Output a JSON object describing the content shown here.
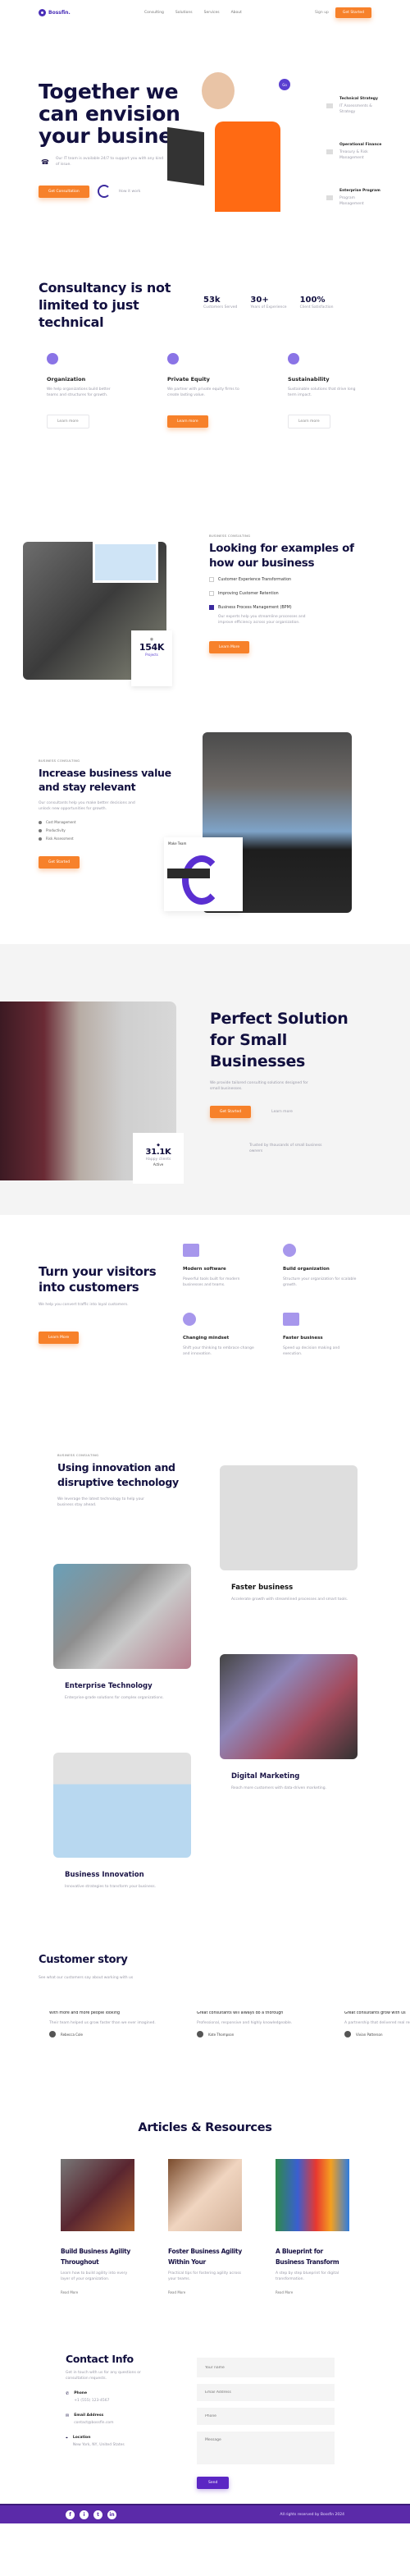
{
  "nav": {
    "brand": "Bossfin.",
    "links": [
      "Consulting",
      "Solutions",
      "Services",
      "About"
    ],
    "login": "Sign up",
    "cta": "Get Started"
  },
  "hero": {
    "title": "Together we can envision your business",
    "desc": "Our IT team is available 24/7 to support you with any kind of issue.",
    "cta": "Get Consultation",
    "video": "How it work",
    "badge": "Go",
    "features": [
      {
        "title": "Technical Strategy",
        "desc": "IT Assessments & Strategy"
      },
      {
        "title": "Operational Finance",
        "desc": "Treasury & Risk Management"
      },
      {
        "title": "Enterprise Program",
        "desc": "Program Management"
      }
    ]
  },
  "consult": {
    "title": "Consultancy is not limited to just technical",
    "stats": [
      {
        "value": "53k",
        "label": "Customers Served"
      },
      {
        "value": "30+",
        "label": "Years of Experience"
      },
      {
        "value": "100%",
        "label": "Client Satisfaction"
      }
    ],
    "cards": [
      {
        "title": "Organization",
        "desc": "We help organizations build better teams and structures for growth.",
        "btn": "Learn more"
      },
      {
        "title": "Private Equity",
        "desc": "We partner with private equity firms to create lasting value.",
        "btn": "Learn more"
      },
      {
        "title": "Sustainability",
        "desc": "Sustainable solutions that drive long term impact.",
        "btn": "Learn more"
      }
    ]
  },
  "examples": {
    "eyebrow": "BUSINESS CONSULTING",
    "title": "Looking for examples of how our business",
    "stat_value": "154K",
    "stat_label": "Projects",
    "items": [
      "Customer Experience Transformation",
      "Improving Customer Retention",
      "Business Process Management (BPM)"
    ],
    "item_desc": "Our experts help you streamline processes and improve efficiency across your organization.",
    "cta": "Learn More"
  },
  "increase": {
    "eyebrow": "BUSINESS CONSULTING",
    "title": "Increase business value and stay relevant",
    "desc": "Our consultants help you make better decisions and unlock new opportunities for growth.",
    "bullets": [
      "Cost Management",
      "Productivity",
      "Risk Assessment"
    ],
    "cta": "Get Started",
    "card_title": "Make Team"
  },
  "perfect": {
    "title": "Perfect Solution for Small Businesses",
    "desc": "We provide tailored consulting solutions designed for small businesses.",
    "cta": "Get Started",
    "link": "Learn more",
    "stat_value": "31.1K",
    "stat_label": "Happy clients",
    "stat_sub": "Active",
    "note": "Trusted by thousands of small business owners"
  },
  "visitors": {
    "title": "Turn your visitors into customers",
    "desc": "We help you convert traffic into loyal customers.",
    "cta": "Learn More",
    "items": [
      {
        "title": "Modern software",
        "desc": "Powerful tools built for modern businesses and teams."
      },
      {
        "title": "Build organization",
        "desc": "Structure your organization for scalable growth."
      },
      {
        "title": "Changing mindset",
        "desc": "Shift your thinking to embrace change and innovation."
      },
      {
        "title": "Faster business",
        "desc": "Speed up decision making and execution."
      }
    ]
  },
  "innovation": {
    "eyebrow": "BUSINESS CONSULTING",
    "title": "Using innovation and disruptive technology",
    "desc": "We leverage the latest technology to help your business stay ahead.",
    "cards": [
      {
        "title": "Faster business",
        "desc": "Accelerate growth with streamlined processes and smart tools."
      },
      {
        "title": "Enterprise Technology",
        "desc": "Enterprise-grade solutions for complex organizations."
      },
      {
        "title": "Digital Marketing",
        "desc": "Reach more customers with data-driven marketing."
      },
      {
        "title": "Business Innovation",
        "desc": "Innovative strategies to transform your business."
      }
    ]
  },
  "stories": {
    "title": "Customer story",
    "subtitle": "See what our customers say about working with us",
    "items": [
      {
        "quote": "With more and more people looking",
        "text": "Their team helped us grow faster than we ever imagined.",
        "author": "Rebecca Cole"
      },
      {
        "quote": "Great consultants will always do a thorough",
        "text": "Professional, responsive and highly knowledgeable.",
        "author": "Kate Thompson"
      },
      {
        "quote": "Great consultants grow with us",
        "text": "A partnership that delivered real results.",
        "author": "Vivian Patterson"
      }
    ]
  },
  "articles": {
    "title": "Articles & Resources",
    "items": [
      {
        "title": "Build Business Agility Throughout",
        "desc": "Learn how to build agility into every layer of your organization.",
        "link": "Read More"
      },
      {
        "title": "Foster Business Agility Within Your",
        "desc": "Practical tips for fostering agility across your teams.",
        "link": "Read More"
      },
      {
        "title": "A Blueprint for Business Transform",
        "desc": "A step by step blueprint for digital transformation.",
        "link": "Read More"
      }
    ]
  },
  "contact": {
    "title": "Contact Info",
    "desc": "Get in touch with us for any questions or consultation requests.",
    "items": [
      {
        "title": "Phone",
        "value": "+1 (555) 123-4567"
      },
      {
        "title": "Email Address",
        "value": "contact@bossfin.com"
      },
      {
        "title": "Location",
        "value": "New York, NY, United States"
      }
    ],
    "form": {
      "name": "Your name",
      "email": "Email Address",
      "phone": "Phone",
      "message": "Message",
      "submit": "Send"
    }
  },
  "footer": {
    "social": [
      "f",
      "i",
      "t",
      "in"
    ],
    "copyright": "All rights reserved by Bossfin 2024"
  }
}
